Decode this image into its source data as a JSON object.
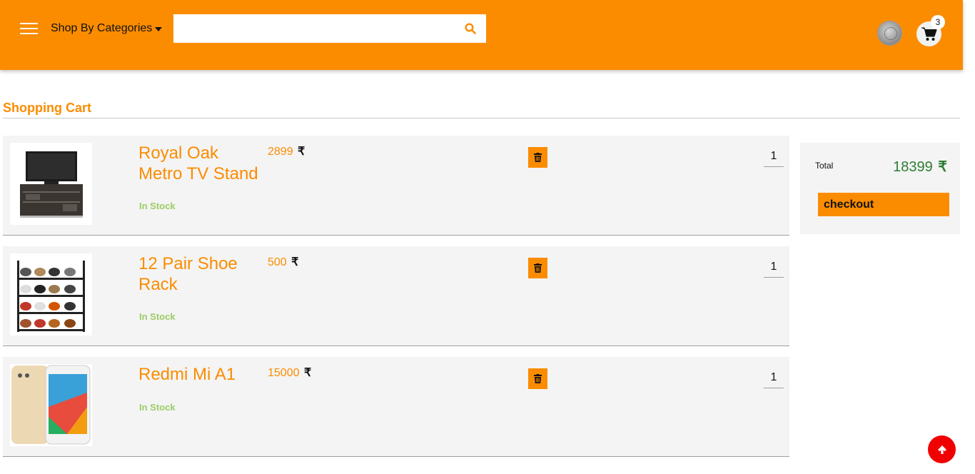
{
  "header": {
    "categories_label": "Shop By Categories",
    "search_placeholder": "",
    "cart_count": "3",
    "brand_color": "#fb8c00"
  },
  "page": {
    "title": "Shopping Cart"
  },
  "currency_symbol": "₹",
  "items": [
    {
      "name": "Royal Oak Metro TV Stand",
      "price": "2899",
      "stock": "In Stock",
      "quantity": "1",
      "image": "tv-stand-image"
    },
    {
      "name": "12 Pair Shoe Rack",
      "price": "500",
      "stock": "In Stock",
      "quantity": "1",
      "image": "shoe-rack-image"
    },
    {
      "name": "Redmi Mi A1",
      "price": "15000",
      "stock": "In Stock",
      "quantity": "1",
      "image": "phone-image"
    }
  ],
  "summary": {
    "total_label": "Total",
    "total_value": "18399",
    "checkout_label": "checkout",
    "total_color": "#2e7d32"
  },
  "icons": {
    "menu": "hamburger-icon",
    "search": "search-icon",
    "cart": "shopping-cart-icon",
    "delete": "trash-icon",
    "scroll_top": "arrow-up-icon"
  }
}
